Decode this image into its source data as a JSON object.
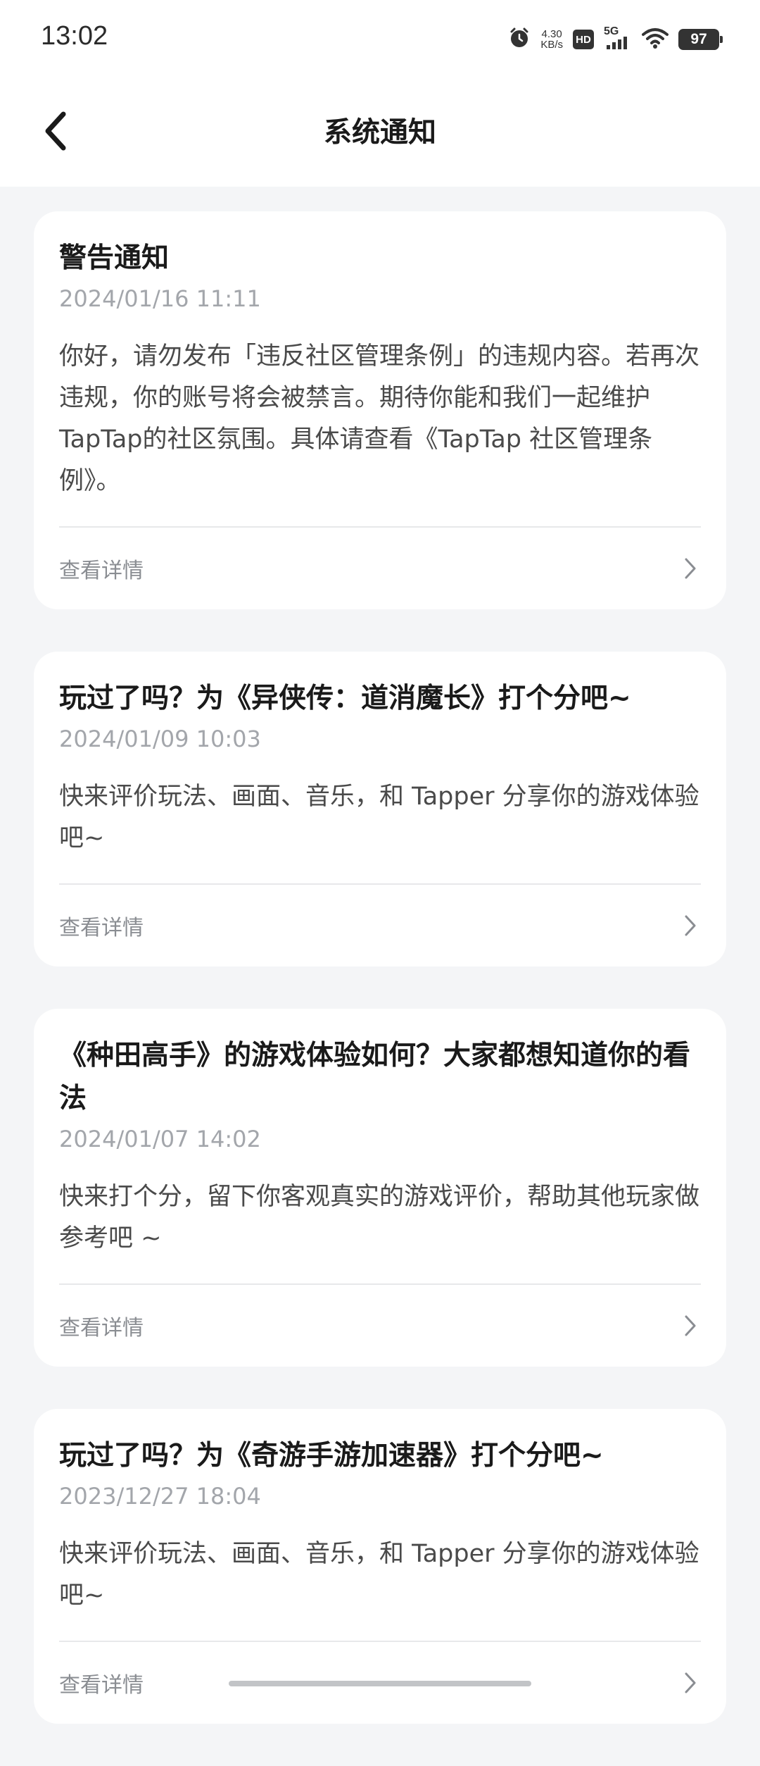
{
  "status_bar": {
    "time": "13:02",
    "net_speed_value": "4.30",
    "net_speed_unit": "KB/s",
    "hd_label": "HD",
    "signal_label": "5G",
    "battery": "97"
  },
  "header": {
    "title": "系统通知"
  },
  "notifications": [
    {
      "title": "警告通知",
      "date": "2024/01/16 11:11",
      "body": "你好，请勿发布「违反社区管理条例」的违规内容。若再次违规，你的账号将会被禁言。期待你能和我们一起维护TapTap的社区氛围。具体请查看《TapTap 社区管理条例》。",
      "details_label": "查看详情"
    },
    {
      "title": "玩过了吗？为《异侠传：道消魔长》打个分吧~",
      "date": "2024/01/09 10:03",
      "body": "快来评价玩法、画面、音乐，和 Tapper 分享你的游戏体验吧~",
      "details_label": "查看详情"
    },
    {
      "title": "《种田高手》的游戏体验如何？大家都想知道你的看法",
      "date": "2024/01/07 14:02",
      "body": "快来打个分，留下你客观真实的游戏评价，帮助其他玩家做参考吧 ~",
      "details_label": "查看详情"
    },
    {
      "title": "玩过了吗？为《奇游手游加速器》打个分吧~",
      "date": "2023/12/27 18:04",
      "body": "快来评价玩法、画面、音乐，和 Tapper 分享你的游戏体验吧~",
      "details_label": "查看详情"
    }
  ],
  "icons": {
    "back": "chevron-left-icon",
    "details": "chevron-right-icon",
    "alarm": "alarm-icon",
    "wifi": "wifi-icon",
    "signal": "signal-bars-icon"
  },
  "colors": {
    "background": "#f4f5f7",
    "card": "#ffffff",
    "title": "#1a1a1a",
    "date": "#a3a6ab",
    "body": "#4a4a4a",
    "link": "#8a8d92"
  }
}
